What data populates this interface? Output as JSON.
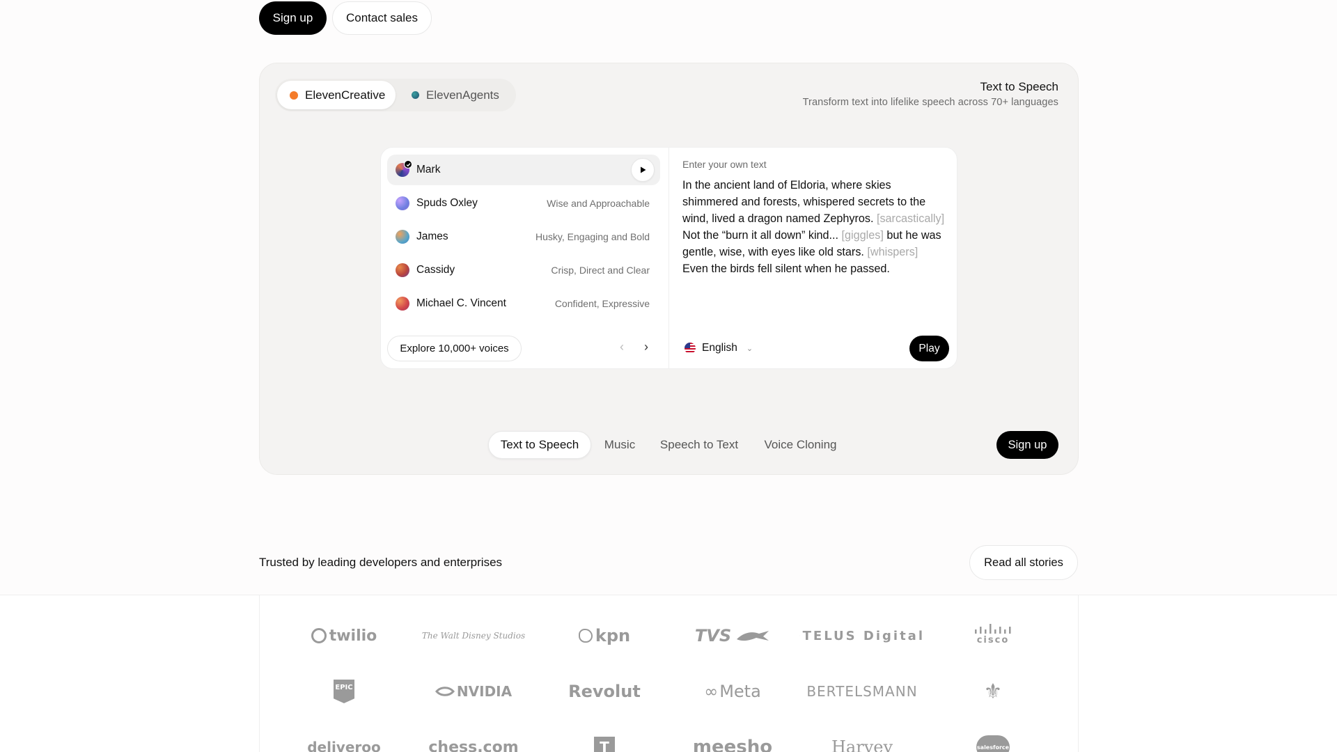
{
  "top_actions": {
    "signup": "Sign up",
    "contact_sales": "Contact sales"
  },
  "segment": {
    "items": [
      {
        "label": "ElevenCreative",
        "color": "#f47b2a",
        "active": true
      },
      {
        "label": "ElevenAgents",
        "color": "#1f7a74",
        "active": false
      }
    ]
  },
  "panel": {
    "title": "Text to Speech",
    "subtitle": "Transform text into lifelike speech across 70+ languages"
  },
  "voices": [
    {
      "name": "Mark",
      "desc": "",
      "selected": true
    },
    {
      "name": "Spuds Oxley",
      "desc": "Wise and Approachable"
    },
    {
      "name": "James",
      "desc": "Husky, Engaging and Bold"
    },
    {
      "name": "Cassidy",
      "desc": "Crisp, Direct and Clear"
    },
    {
      "name": "Michael C. Vincent",
      "desc": "Confident, Expressive"
    }
  ],
  "explore_label": "Explore 10,000+ voices",
  "pager": {
    "prev": "‹",
    "next": "›"
  },
  "editor": {
    "label": "Enter your own text",
    "text_1": "In the ancient land of Eldoria, where skies shimmered and forests, whispered secrets to the wind, lived a dragon named Zephyros.",
    "tag_1": "[sarcastically]",
    "text_2": " Not the “burn it all down” kind...",
    "tag_2": "[giggles]",
    "text_3": " but he was gentle, wise, with eyes like old stars. ",
    "tag_3": "[whispers]",
    "text_4": " Even the birds fell silent when he passed."
  },
  "language": {
    "selected": "English",
    "chevron": "⌄"
  },
  "play_label": "Play",
  "tabs": [
    {
      "label": "Text to Speech",
      "active": true
    },
    {
      "label": "Music"
    },
    {
      "label": "Speech to Text"
    },
    {
      "label": "Voice Cloning"
    }
  ],
  "bottom_signup": "Sign up",
  "trusted": {
    "heading": "Trusted by leading developers and enterprises",
    "read_all": "Read all stories"
  },
  "logos": {
    "row1": [
      "twilio",
      "The Walt Disney Studios",
      "kpn",
      "TVS",
      "TELUS Digital",
      "cisco"
    ],
    "row2": [
      "EPIC",
      "NVIDIA",
      "Revolut",
      "Meta",
      "BERTELSMANN",
      "⚜"
    ],
    "row3": [
      "deliveroo",
      "chess.com",
      "T",
      "meesho",
      "Harvey",
      "salesforce"
    ]
  }
}
